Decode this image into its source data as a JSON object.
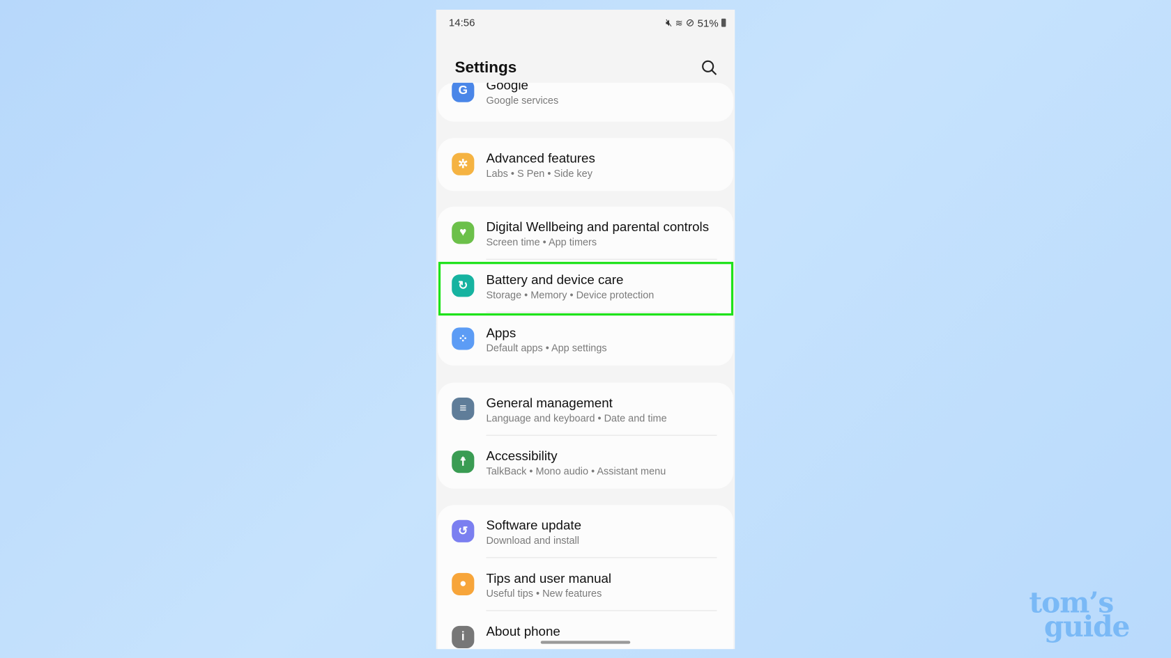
{
  "status": {
    "time": "14:56",
    "battery": "51%",
    "icons": [
      "mute-icon",
      "wifi-icon",
      "do-not-disturb-icon",
      "battery-icon"
    ]
  },
  "header": {
    "title": "Settings",
    "search_icon": "search-icon"
  },
  "groups": [
    [
      {
        "title": "Google",
        "subtitle": "Google services",
        "icon": "google-icon",
        "color": "#4a86e8"
      }
    ],
    [
      {
        "title": "Advanced features",
        "subtitle": "Labs  •  S Pen  •  Side key",
        "icon": "advanced-features-icon",
        "color": "#f5b342"
      }
    ],
    [
      {
        "title": "Digital Wellbeing and parental controls",
        "subtitle": "Screen time  •  App timers",
        "icon": "wellbeing-icon",
        "color": "#6cc04a"
      },
      {
        "title": "Battery and device care",
        "subtitle": "Storage  •  Memory  •  Device protection",
        "icon": "device-care-icon",
        "color": "#16b3a0",
        "highlighted": true
      },
      {
        "title": "Apps",
        "subtitle": "Default apps  •  App settings",
        "icon": "apps-icon",
        "color": "#5c9cf5"
      }
    ],
    [
      {
        "title": "General management",
        "subtitle": "Language and keyboard  •  Date and time",
        "icon": "general-management-icon",
        "color": "#5f7d99"
      },
      {
        "title": "Accessibility",
        "subtitle": "TalkBack  •  Mono audio  •  Assistant menu",
        "icon": "accessibility-icon",
        "color": "#3a9c53"
      }
    ],
    [
      {
        "title": "Software update",
        "subtitle": "Download and install",
        "icon": "software-update-icon",
        "color": "#7b7ff0"
      },
      {
        "title": "Tips and user manual",
        "subtitle": "Useful tips  •  New features",
        "icon": "tips-icon",
        "color": "#f7a53a"
      },
      {
        "title": "About phone",
        "subtitle": "",
        "icon": "about-phone-icon",
        "color": "#777777"
      }
    ]
  ],
  "highlight_color": "#1ee21a",
  "watermark": "tom's guide"
}
